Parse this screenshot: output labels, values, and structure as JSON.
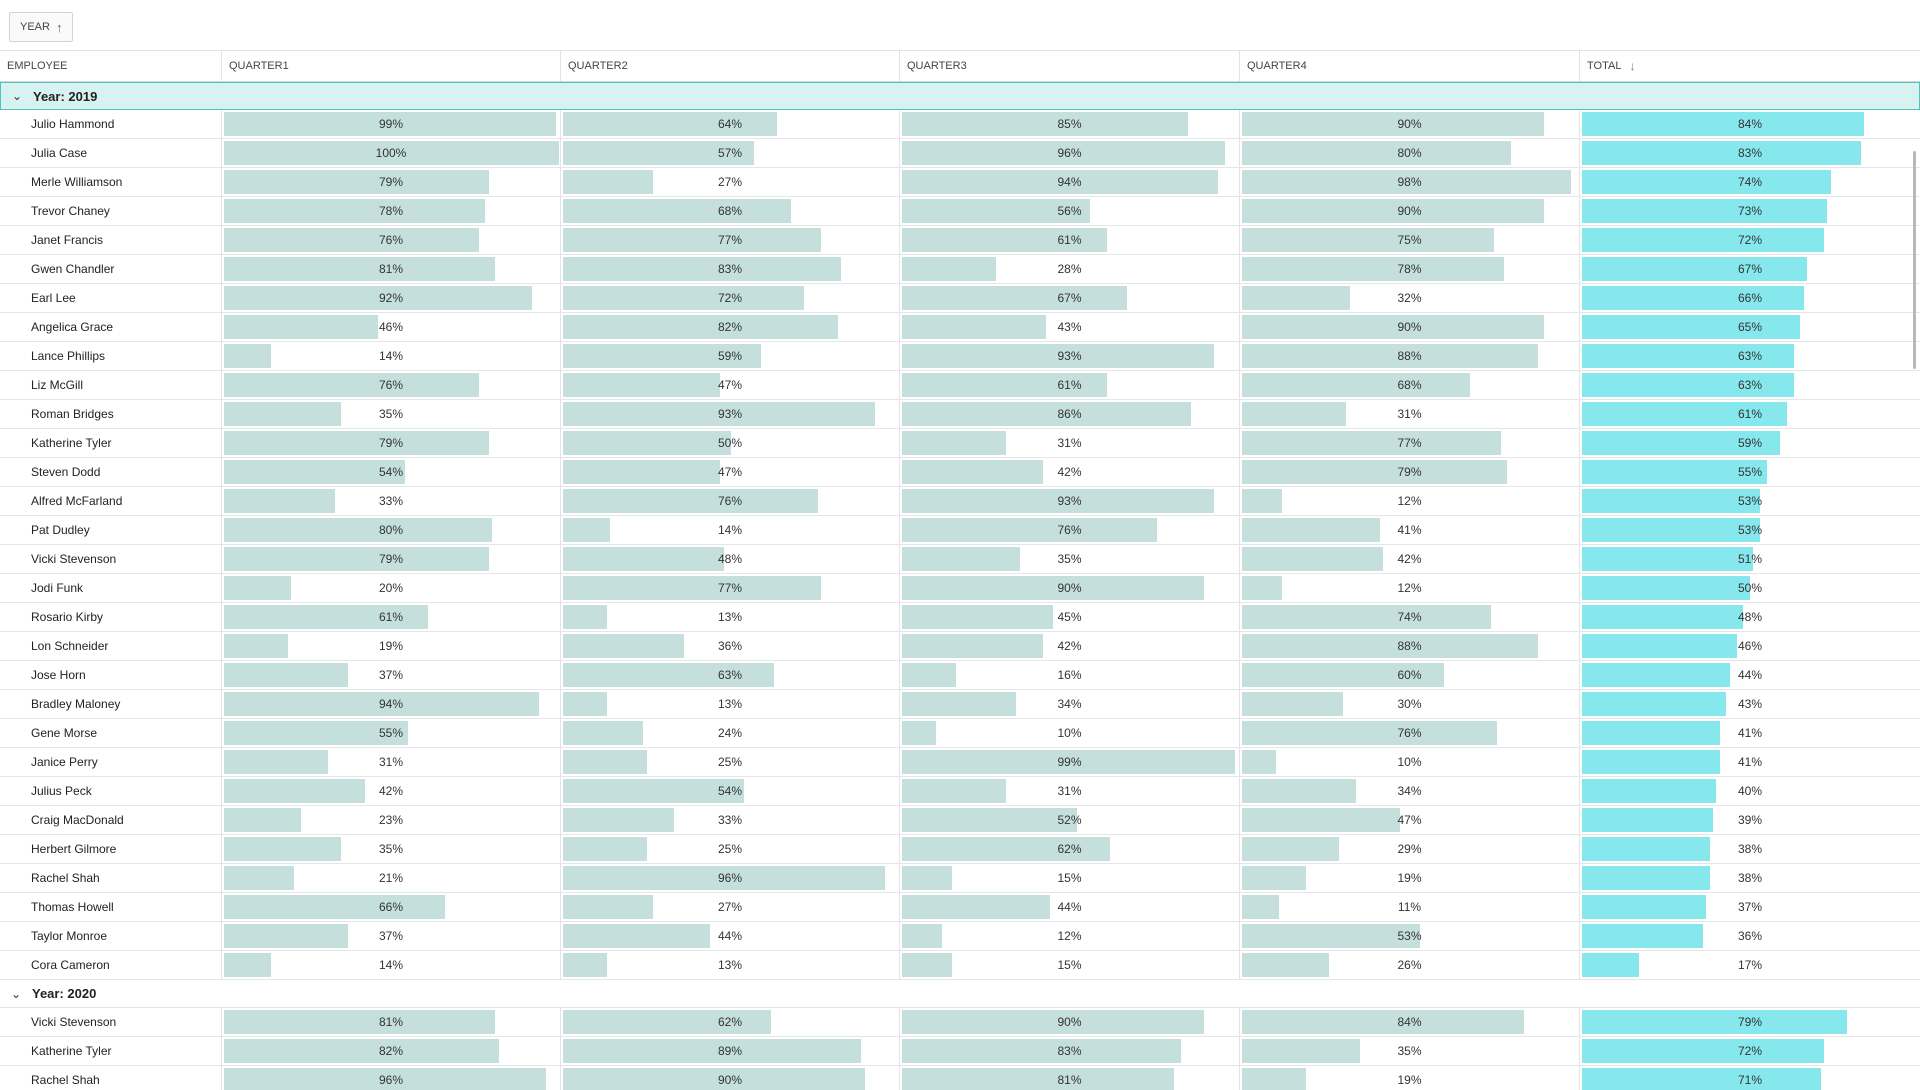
{
  "toolbar": {
    "group_chip_label": "YEAR"
  },
  "columns": {
    "employee": "EMPLOYEE",
    "q1": "QUARTER1",
    "q2": "QUARTER2",
    "q3": "QUARTER3",
    "q4": "QUARTER4",
    "total": "TOTAL"
  },
  "groups": [
    {
      "label": "Year: 2019",
      "rows": [
        [
          "Julio Hammond",
          99,
          64,
          85,
          90,
          84
        ],
        [
          "Julia Case",
          100,
          57,
          96,
          80,
          83
        ],
        [
          "Merle Williamson",
          79,
          27,
          94,
          98,
          74
        ],
        [
          "Trevor Chaney",
          78,
          68,
          56,
          90,
          73
        ],
        [
          "Janet Francis",
          76,
          77,
          61,
          75,
          72
        ],
        [
          "Gwen Chandler",
          81,
          83,
          28,
          78,
          67
        ],
        [
          "Earl Lee",
          92,
          72,
          67,
          32,
          66
        ],
        [
          "Angelica Grace",
          46,
          82,
          43,
          90,
          65
        ],
        [
          "Lance Phillips",
          14,
          59,
          93,
          88,
          63
        ],
        [
          "Liz McGill",
          76,
          47,
          61,
          68,
          63
        ],
        [
          "Roman Bridges",
          35,
          93,
          86,
          31,
          61
        ],
        [
          "Katherine Tyler",
          79,
          50,
          31,
          77,
          59
        ],
        [
          "Steven Dodd",
          54,
          47,
          42,
          79,
          55
        ],
        [
          "Alfred McFarland",
          33,
          76,
          93,
          12,
          53
        ],
        [
          "Pat Dudley",
          80,
          14,
          76,
          41,
          53
        ],
        [
          "Vicki Stevenson",
          79,
          48,
          35,
          42,
          51
        ],
        [
          "Jodi Funk",
          20,
          77,
          90,
          12,
          50
        ],
        [
          "Rosario Kirby",
          61,
          13,
          45,
          74,
          48
        ],
        [
          "Lon Schneider",
          19,
          36,
          42,
          88,
          46
        ],
        [
          "Jose Horn",
          37,
          63,
          16,
          60,
          44
        ],
        [
          "Bradley Maloney",
          94,
          13,
          34,
          30,
          43
        ],
        [
          "Gene Morse",
          55,
          24,
          10,
          76,
          41
        ],
        [
          "Janice Perry",
          31,
          25,
          99,
          10,
          41
        ],
        [
          "Julius Peck",
          42,
          54,
          31,
          34,
          40
        ],
        [
          "Craig MacDonald",
          23,
          33,
          52,
          47,
          39
        ],
        [
          "Herbert Gilmore",
          35,
          25,
          62,
          29,
          38
        ],
        [
          "Rachel Shah",
          21,
          96,
          15,
          19,
          38
        ],
        [
          "Thomas Howell",
          66,
          27,
          44,
          11,
          37
        ],
        [
          "Taylor Monroe",
          37,
          44,
          12,
          53,
          36
        ],
        [
          "Cora Cameron",
          14,
          13,
          15,
          26,
          17
        ]
      ]
    },
    {
      "label": "Year: 2020",
      "rows": [
        [
          "Vicki Stevenson",
          81,
          62,
          90,
          84,
          79
        ],
        [
          "Katherine Tyler",
          82,
          89,
          83,
          35,
          72
        ],
        [
          "Rachel Shah",
          96,
          90,
          81,
          19,
          71
        ]
      ]
    }
  ],
  "colors": {
    "bar": "#c5e0dc",
    "total_bar": "#86e8ec",
    "group_active_bg": "#d8f1f1",
    "group_active_border": "#4fc2c2"
  },
  "icons": {
    "sort_up": "arrow-up-icon",
    "sort_down": "arrow-down-icon",
    "collapse": "chevron-down-icon"
  }
}
